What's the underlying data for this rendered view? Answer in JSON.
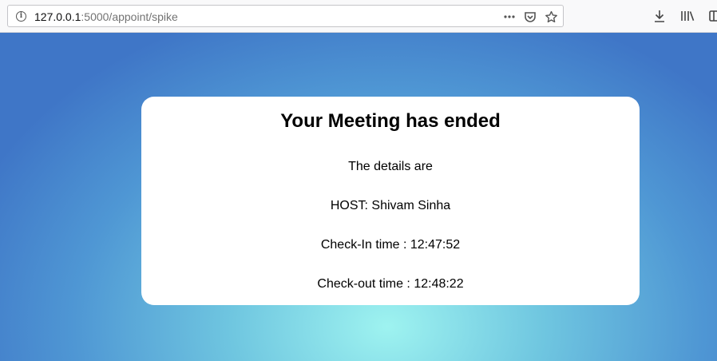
{
  "browser": {
    "url_host": "127.0.0.1",
    "url_rest": ":5000/appoint/spike",
    "url_icons": [
      "more-actions-icon",
      "pocket-icon",
      "bookmark-star-icon"
    ],
    "toolbar_icons": [
      "download-icon",
      "library-icon",
      "sidebar-icon"
    ]
  },
  "card": {
    "title": "Your Meeting has ended",
    "intro": "The details are",
    "host": "HOST: Shivam Sinha",
    "checkin": "Check-In time : 12:47:52",
    "checkout": "Check-out time : 12:48:22"
  },
  "colors": {
    "gradient_center": "#9ef3f0",
    "gradient_edge": "#3f76c7",
    "card_background": "#ffffff"
  }
}
